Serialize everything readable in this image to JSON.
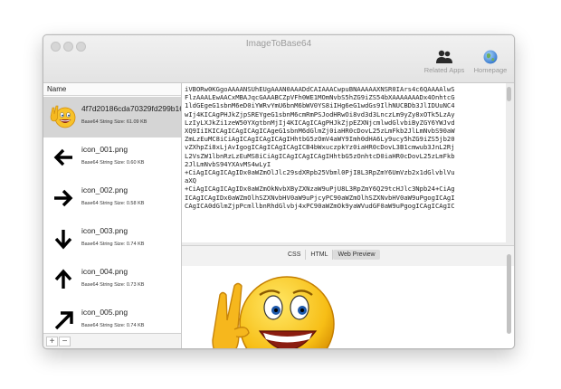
{
  "window": {
    "title": "ImageToBase64"
  },
  "toolbar": {
    "related_apps_label": "Related Apps",
    "homepage_label": "Homepage"
  },
  "sidebar": {
    "column_header": "Name",
    "items": [
      {
        "name": "4f7d20186cda70329fd299b165241",
        "size": "Base64 String Size: 61.09 KB",
        "icon": "smiley-emoji-thumbnail",
        "selected": true
      },
      {
        "name": "icon_001.png",
        "size": "Base64 String Size: 0.60 KB",
        "icon": "arrow-left-icon"
      },
      {
        "name": "icon_002.png",
        "size": "Base64 String Size: 0.58 KB",
        "icon": "arrow-right-icon"
      },
      {
        "name": "icon_003.png",
        "size": "Base64 String Size: 0.74 KB",
        "icon": "arrow-down-icon"
      },
      {
        "name": "icon_004.png",
        "size": "Base64 String Size: 0.73 KB",
        "icon": "arrow-up-icon"
      },
      {
        "name": "icon_005.png",
        "size": "Base64 String Size: 0.74 KB",
        "icon": "arrow-up-right-icon"
      }
    ],
    "add_label": "+",
    "remove_label": "−"
  },
  "code": {
    "lines": [
      "iVBORw0KGgoAAAANSUhEUgAAAN0AAADdCAIAAACwpuBNAAAAAXNSR0IArs4c6QAAAAlwS",
      "FlzAAALEwAACxMBAJqcGAAABCZpVFh0WE1MOmNvbS5hZG9iZS54bXAAAAAAADx4OnhtcG",
      "1ldGEgeG1sbnM6eD0iYWRvYmU6bnM6bWV0YS8iIHg6eG1wdGs9IlhNUCBDb3JlIDUuNC4",
      "wIj4KICAgPHJkZjpSREYgeG1sbnM6cmRmPSJodHRwOi8vd3d3LnczLm9yZy8xOTk5LzAy",
      "LzIyLXJkZi1zeW50YXgtbnMjIj4KICAgICAgPHJkZjpEZXNjcmlwdGlvbiByZGY6YWJvd",
      "XQ9IiIKICAgICAgICAgICAgeG1sbnM6dGlmZj0iaHR0cDovL25zLmFkb2JlLmNvbS90aW",
      "ZmLzEuMC8iCiAgICAgICAgICAgIHhtbG5zOmV4aWY9Imh0dHA6Ly9ucy5hZG9iZS5jb20",
      "vZXhpZi8xLjAvIgogICAgICAgICAgICB4bWxuczpkYz0iaHR0cDovL3B1cmwub3JnL2Rj",
      "L2VsZW1lbnRzLzEuMS8iCiAgICAgICAgICAgIHhtbG5zOnhtcD0iaHR0cDovL25zLmFkb",
      "2JlLmNvbS94YXAvMS4wLyI",
      "+CiAgICAgICAgIDx0aWZmOlJlc29sdXRpb25Vbml0PjI8L3RpZmY6UmVzb2x1dGlvblVu",
      "aXQ",
      "+CiAgICAgICAgIDx0aWZmOkNvbXByZXNzaW9uPjU8L3RpZmY6Q29tcHJlc3Npb24+CiAg",
      "ICAgICAgIDx0aWZmOlhSZXNvbHV0aW9uPjcyPC90aWZmOlhSZXNvbHV0aW9uPgogICAgI",
      "CAgICA0dGlmZjpPcmllbnRhdGlvbj4xPC90aWZmOk9yaWVudGF0aW9uPgogICAgICAgIC"
    ]
  },
  "tabs": [
    {
      "label": "CSS",
      "active": false
    },
    {
      "label": "HTML",
      "active": false
    },
    {
      "label": "Web Preview",
      "active": true
    }
  ],
  "colors": {
    "selected_row": "#d5d5d5",
    "window_bg": "#ececec"
  }
}
